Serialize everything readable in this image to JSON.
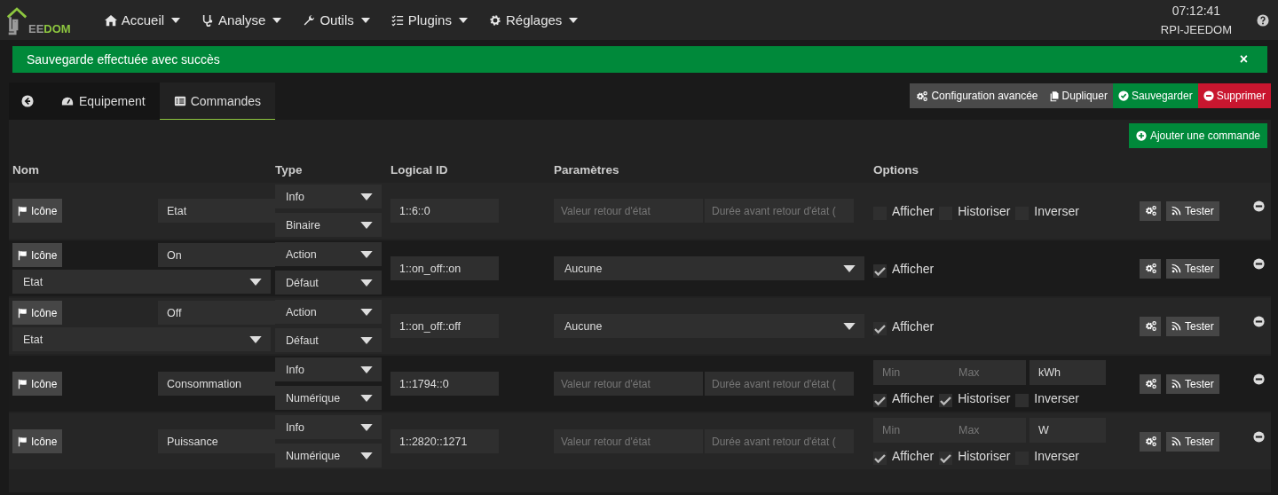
{
  "navbar": {
    "logo_parts": [
      "EE",
      "DOM"
    ],
    "menus": [
      {
        "label": "Accueil"
      },
      {
        "label": "Analyse"
      },
      {
        "label": "Outils"
      },
      {
        "label": "Plugins"
      },
      {
        "label": "Réglages"
      }
    ],
    "clock": "07:12:41",
    "host": "RPI-JEEDOM"
  },
  "alert": {
    "message": "Sauvegarde effectuée avec succès",
    "close": "×"
  },
  "tabs": [
    {
      "kind": "back",
      "selected": false
    },
    {
      "label": "Equipement",
      "kind": "equipment",
      "selected": false
    },
    {
      "label": "Commandes",
      "kind": "commands",
      "selected": true
    }
  ],
  "actions": [
    {
      "label": "Configuration avancée",
      "kind": "config"
    },
    {
      "label": "Dupliquer",
      "kind": "duplicate"
    },
    {
      "label": "Sauvegarder",
      "kind": "save"
    },
    {
      "label": "Supprimer",
      "kind": "delete"
    }
  ],
  "add_button": "Ajouter une commande",
  "columns": [
    "Nom",
    "Type",
    "Logical ID",
    "Paramètres",
    "Options"
  ],
  "commands": [
    {
      "icon_button": "Icône",
      "name": "Etat",
      "type": "Info",
      "subtype": "Binaire",
      "logical_id": "1::6::0",
      "params": {
        "kind": "inputs",
        "placeholders": [
          "Valeur retour d'état",
          "Durée avant retour d'état ("
        ]
      },
      "options": [
        {
          "label": "Afficher",
          "checked": false
        },
        {
          "label": "Historiser",
          "checked": false
        },
        {
          "label": "Inverser",
          "checked": false
        }
      ],
      "test_button": "Tester"
    },
    {
      "icon_button": "Icône",
      "name": "On",
      "value_select": "Etat",
      "type": "Action",
      "subtype": "Défaut",
      "logical_id": "1::on_off::on",
      "params": {
        "kind": "select",
        "value": "Aucune"
      },
      "options": [
        {
          "label": "Afficher",
          "checked": true
        }
      ],
      "test_button": "Tester"
    },
    {
      "icon_button": "Icône",
      "name": "Off",
      "value_select": "Etat",
      "type": "Action",
      "subtype": "Défaut",
      "logical_id": "1::on_off::off",
      "params": {
        "kind": "select",
        "value": "Aucune"
      },
      "options": [
        {
          "label": "Afficher",
          "checked": true
        }
      ],
      "test_button": "Tester"
    },
    {
      "icon_button": "Icône",
      "name": "Consommation",
      "type": "Info",
      "subtype": "Numérique",
      "logical_id": "1::1794::0",
      "params": {
        "kind": "inputs",
        "placeholders": [
          "Valeur retour d'état",
          "Durée avant retour d'état ("
        ]
      },
      "range": {
        "min_placeholder": "Min",
        "max_placeholder": "Max",
        "unit": "kWh"
      },
      "options": [
        {
          "label": "Afficher",
          "checked": true
        },
        {
          "label": "Historiser",
          "checked": true
        },
        {
          "label": "Inverser",
          "checked": false
        }
      ],
      "test_button": "Tester"
    },
    {
      "icon_button": "Icône",
      "name": "Puissance",
      "type": "Info",
      "subtype": "Numérique",
      "logical_id": "1::2820::1271",
      "params": {
        "kind": "inputs",
        "placeholders": [
          "Valeur retour d'état",
          "Durée avant retour d'état ("
        ]
      },
      "range": {
        "min_placeholder": "Min",
        "max_placeholder": "Max",
        "unit": "W"
      },
      "options": [
        {
          "label": "Afficher",
          "checked": true
        },
        {
          "label": "Historiser",
          "checked": true
        },
        {
          "label": "Inverser",
          "checked": false
        }
      ],
      "test_button": "Tester"
    }
  ]
}
